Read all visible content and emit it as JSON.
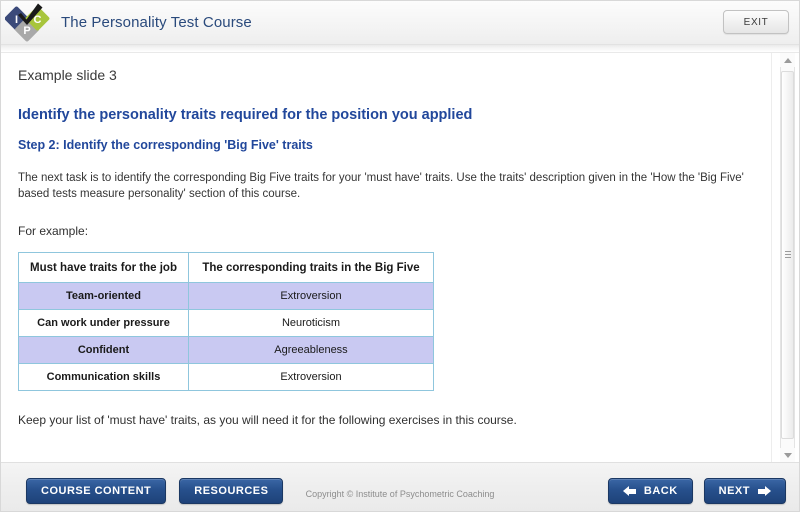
{
  "header": {
    "title": "The Personality Test Course",
    "exit_label": "EXIT",
    "title_color": "#2a4a7c",
    "logo": {
      "name": "ipc-logo",
      "letters": [
        "I",
        "C",
        "P"
      ],
      "colors": {
        "i_diamond": "#3b4a7a",
        "c_diamond": "#a8c53c",
        "p_diamond": "#a9a9a9",
        "check": "#1a1a1a"
      }
    }
  },
  "content": {
    "slide_label": "Example slide 3",
    "heading": "Identify the personality traits required for the position you applied",
    "step_heading": "Step 2: Identify the corresponding 'Big Five' traits",
    "paragraph": "The next task is to identify the corresponding Big Five traits for your 'must have' traits. Use the traits' description given in the 'How the 'Big Five' based tests measure personality' section of this course.",
    "example_label": "For example:",
    "closing_paragraph": "Keep your list of 'must have' traits, as you will need it for the following exercises in this course.",
    "heading_color": "#21479b",
    "table": {
      "columns": [
        "Must have traits for the job",
        "The corresponding traits in the Big Five"
      ],
      "rows": [
        {
          "trait": "Team-oriented",
          "bigfive": "Extroversion",
          "highlight": true
        },
        {
          "trait": "Can work under pressure",
          "bigfive": "Neuroticism",
          "highlight": false
        },
        {
          "trait": "Confident",
          "bigfive": "Agreeableness",
          "highlight": true
        },
        {
          "trait": "Communication skills",
          "bigfive": "Extroversion",
          "highlight": false
        }
      ],
      "border_color": "#8fc6dd",
      "highlight_color": "#c9c9f2"
    }
  },
  "scrollbar": {
    "up_icon": "triangle-up-icon",
    "down_icon": "triangle-down-icon"
  },
  "footer": {
    "course_content_label": "COURSE CONTENT",
    "resources_label": "RESOURCES",
    "copyright": "Copyright © Institute of Psychometric Coaching",
    "back_label": "BACK",
    "next_label": "NEXT",
    "button_color": "#27508c"
  }
}
